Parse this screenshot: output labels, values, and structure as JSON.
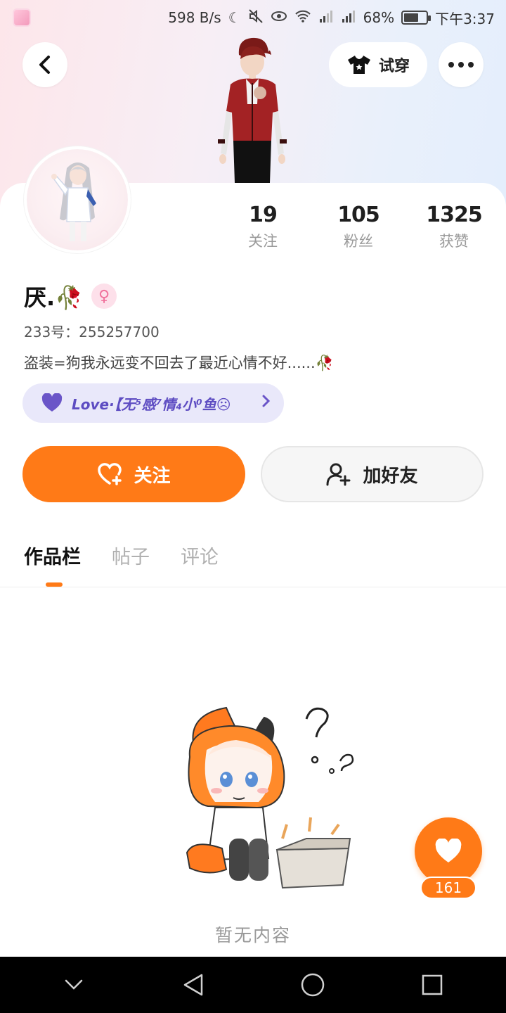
{
  "status_bar": {
    "speed": "598 B/s",
    "battery_percent": "68%",
    "battery_level": 0.68,
    "time": "下午3:37",
    "icons": [
      "moon-icon",
      "mute-icon",
      "eye-icon",
      "wifi-icon",
      "signal-icon",
      "signal-icon",
      "battery-icon"
    ]
  },
  "header": {
    "try_on_label": "试穿"
  },
  "stats": {
    "following": {
      "value": "19",
      "label": "关注"
    },
    "fans": {
      "value": "105",
      "label": "粉丝"
    },
    "likes": {
      "value": "1325",
      "label": "获赞"
    }
  },
  "profile": {
    "username": "厌.🥀",
    "gender_symbol": "♀",
    "uid_text": "233号：255257700",
    "bio": "盗装=狗我永远变不回去了最近心情不好......🥀"
  },
  "love_pill": {
    "text": "Love·【无⁵感⁷情₄小⁰鱼☹"
  },
  "actions": {
    "follow_label": "关注",
    "add_friend_label": "加好友"
  },
  "tabs": [
    {
      "label": "作品栏",
      "active": true
    },
    {
      "label": "帖子",
      "active": false
    },
    {
      "label": "评论",
      "active": false
    }
  ],
  "empty_state": {
    "text": "暂无内容"
  },
  "like_fab": {
    "count": "161"
  },
  "colors": {
    "accent": "#ff7a17",
    "love_pill_bg": "#e9e8fa",
    "love_pill_fg": "#5d4cc2",
    "gender_pink": "#f0709b"
  }
}
